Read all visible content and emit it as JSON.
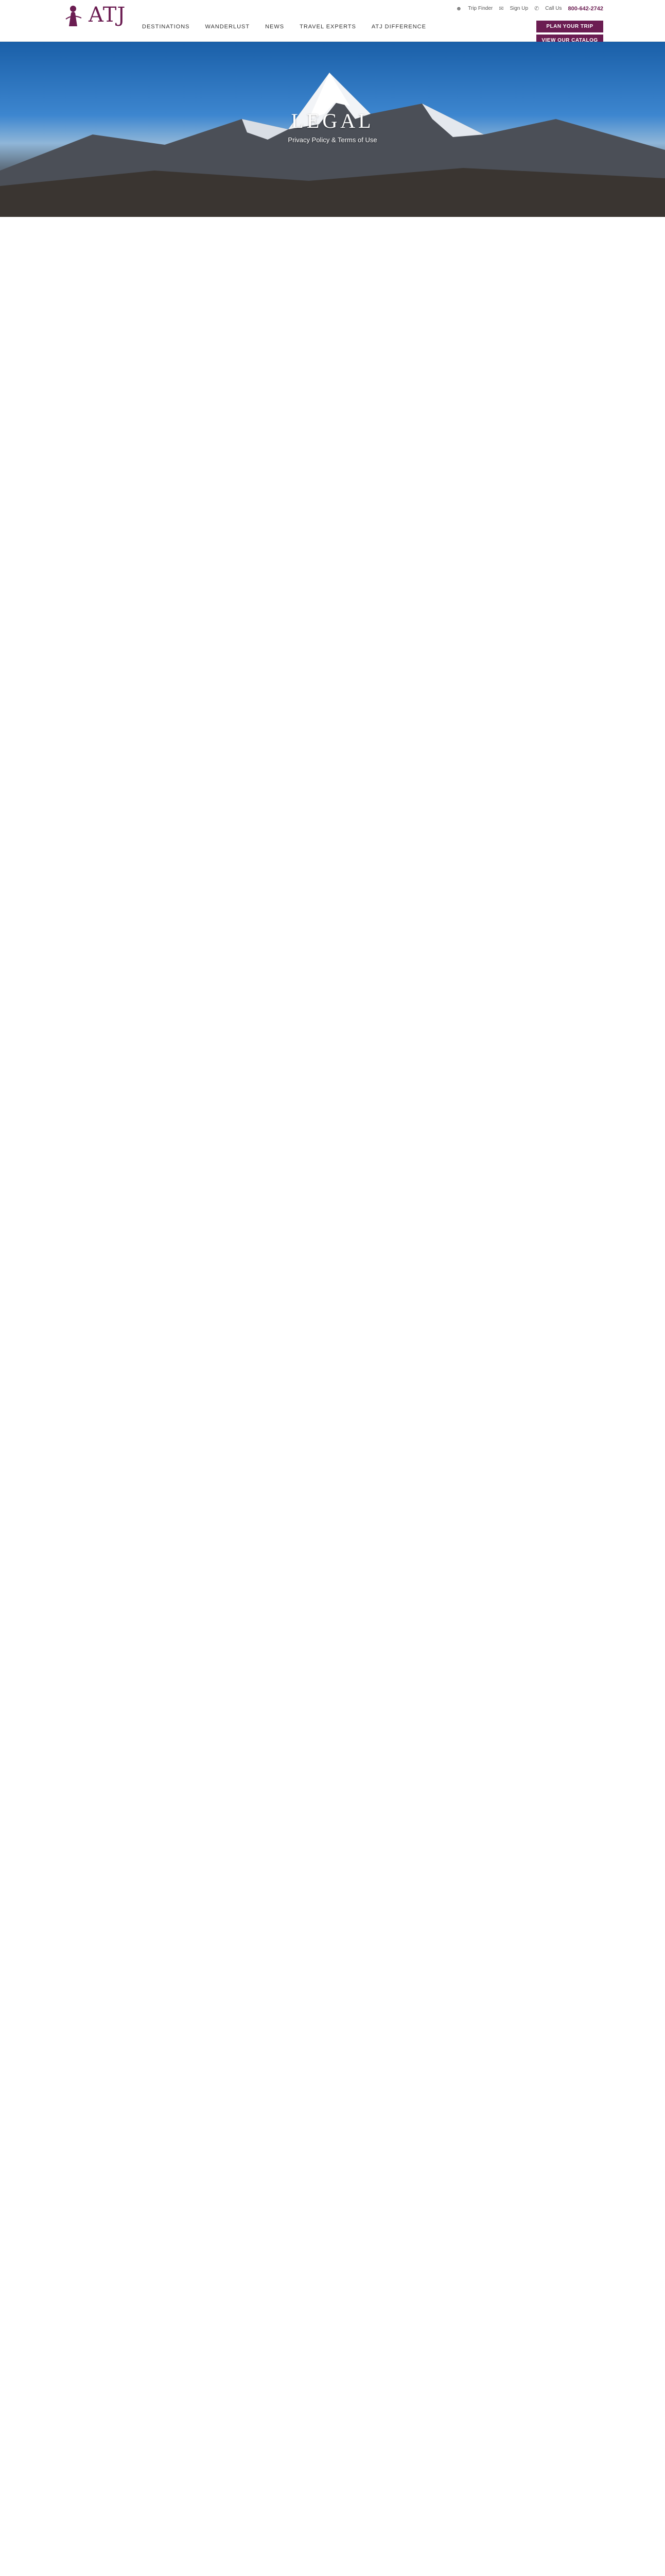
{
  "brand": {
    "name": "ATJ",
    "logo_icon": "person-silhouette-icon"
  },
  "utility": {
    "items": [
      {
        "icon": "user-icon",
        "label": "Trip Finder"
      },
      {
        "icon": "mail-icon",
        "label": "Sign Up"
      },
      {
        "icon": "phone-icon",
        "label": "Call Us",
        "value": "800-642-2742"
      }
    ]
  },
  "nav": {
    "items": [
      "Destinations",
      "Wanderlust",
      "News",
      "Travel Experts",
      "ATJ Difference"
    ]
  },
  "actions": {
    "plan_trip": "Plan Your Trip",
    "catalog": "View Our Catalog"
  },
  "hero": {
    "title": "Legal",
    "subtitle": "Privacy Policy & Terms of Use"
  },
  "colors": {
    "brand_purple": "#6b1d52",
    "text": "#333333"
  }
}
